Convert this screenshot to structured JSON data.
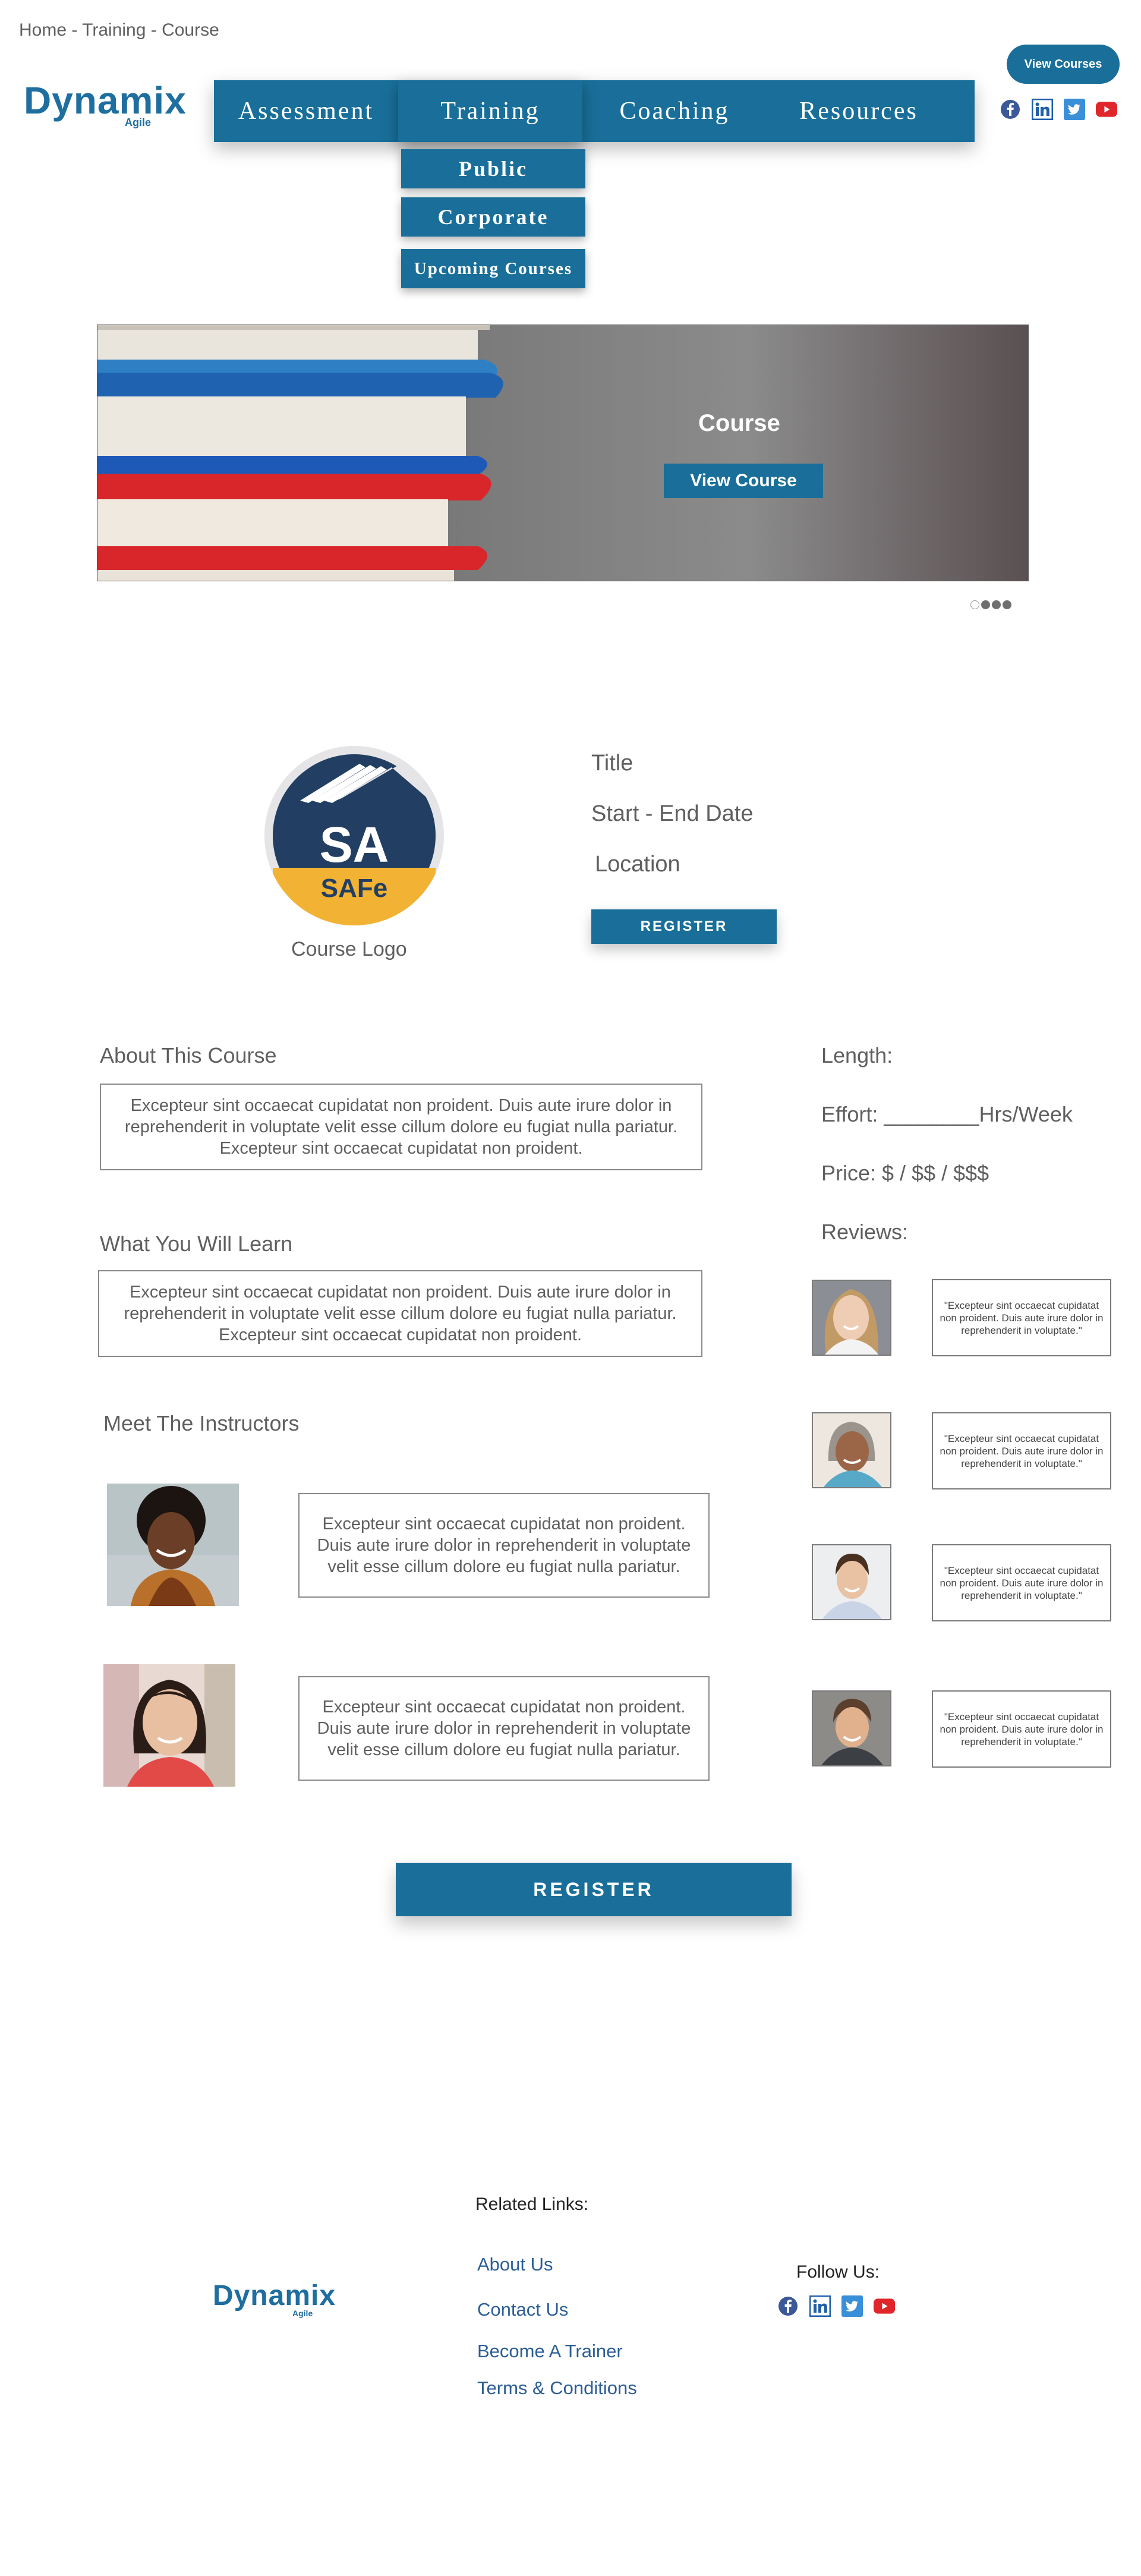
{
  "breadcrumb": "Home - Training - Course",
  "top_cta": "View Courses",
  "logo": {
    "word": "Dynamix",
    "sub": "Agile"
  },
  "nav": {
    "items": [
      "Assessment",
      "Training",
      "Coaching",
      "Resources"
    ],
    "active": "Training",
    "training_submenu": [
      "Public",
      "Corporate",
      "Upcoming Courses"
    ]
  },
  "social_icons": [
    "facebook-icon",
    "linkedin-icon",
    "twitter-icon",
    "youtube-icon"
  ],
  "hero": {
    "title": "Course",
    "button": "View Course",
    "slide_count": 4,
    "current_slide": 1
  },
  "course": {
    "badge": {
      "letters": "SA",
      "brand": "SAFe"
    },
    "logo_label": "Course Logo",
    "title": "Title",
    "dates": "Start - End Date",
    "location": "Location",
    "register": "REGISTER"
  },
  "about": {
    "heading": "About This Course",
    "text": "Excepteur sint occaecat cupidatat non proident. Duis aute irure dolor in reprehenderit in voluptate velit esse cillum dolore eu fugiat nulla pariatur. Excepteur sint occaecat cupidatat non proident."
  },
  "learn": {
    "heading": "What You Will Learn",
    "text": "Excepteur sint occaecat cupidatat non proident. Duis aute irure dolor in reprehenderit in voluptate velit esse cillum dolore eu fugiat nulla pariatur. Excepteur sint occaecat cupidatat non proident."
  },
  "instructors": {
    "heading": "Meet The Instructors",
    "items": [
      {
        "bio": "Excepteur sint occaecat cupidatat non proident. Duis aute irure dolor in reprehenderit in voluptate velit esse cillum dolore eu fugiat nulla pariatur."
      },
      {
        "bio": "Excepteur sint occaecat cupidatat non proident. Duis aute irure dolor in reprehenderit in voluptate velit esse cillum dolore eu fugiat nulla pariatur."
      }
    ]
  },
  "details": {
    "length": "Length:",
    "effort": "Effort: ________Hrs/Week",
    "price": "Price: $ / $$ / $$$",
    "reviews_heading": "Reviews:"
  },
  "reviews": [
    {
      "quote": "\"Excepteur sint occaecat cupidatat non proident. Duis aute irure dolor in reprehenderit in voluptate.\""
    },
    {
      "quote": "\"Excepteur sint occaecat cupidatat non proident. Duis aute irure dolor in reprehenderit in voluptate.\""
    },
    {
      "quote": "\"Excepteur sint occaecat cupidatat non proident. Duis aute irure dolor in reprehenderit in voluptate.\""
    },
    {
      "quote": "\"Excepteur sint occaecat cupidatat non proident. Duis aute irure dolor in reprehenderit in voluptate.\""
    }
  ],
  "register_bottom": "REGISTER",
  "footer": {
    "related_heading": "Related Links:",
    "links": [
      "About Us",
      "Contact Us",
      "Become A Trainer",
      "Terms & Conditions"
    ],
    "follow": "Follow Us:"
  },
  "colors": {
    "brand_blue": "#196f99",
    "link_blue": "#2b5e96",
    "text_gray": "#5f5f5f"
  }
}
